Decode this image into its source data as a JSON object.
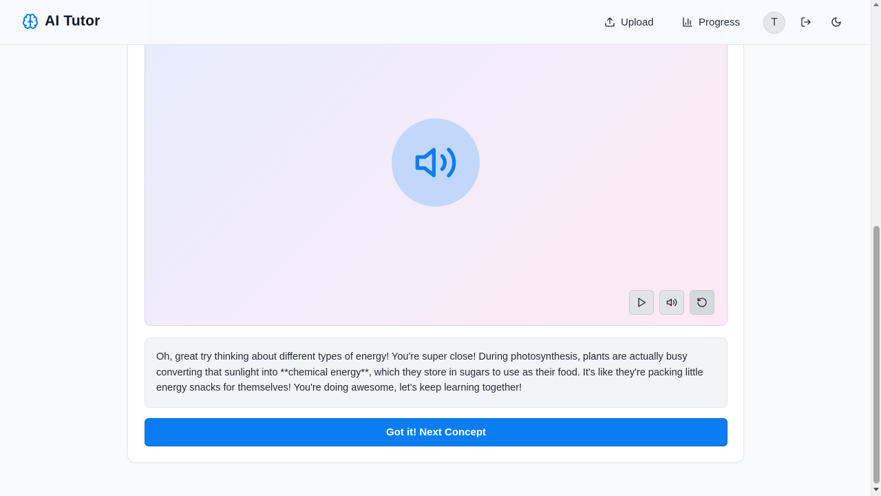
{
  "header": {
    "brand_title": "AI Tutor",
    "brand_icon": "brain-icon",
    "upload_label": "Upload",
    "progress_label": "Progress",
    "avatar_initial": "T",
    "logout_icon": "logout-icon",
    "theme_icon": "moon-icon"
  },
  "player": {
    "center_icon": "speaker-volume-icon",
    "controls": [
      {
        "name": "play-button",
        "icon": "play-icon"
      },
      {
        "name": "audio-button",
        "icon": "volume-icon"
      },
      {
        "name": "replay-button",
        "icon": "rotate-ccw-icon"
      }
    ]
  },
  "feedback": {
    "text": "Oh, great try thinking about different types of energy! You're super close! During photosynthesis, plants are actually busy converting that sunlight into **chemical energy**, which they store in sugars to use as their food. It's like they're packing little energy snacks for themselves! You're doing awesome, let's keep learning together!"
  },
  "actions": {
    "next_label": "Got it! Next Concept"
  },
  "colors": {
    "accent": "#0b7df2",
    "speaker_circle": "#c3d7fb",
    "speaker_icon": "#0b7df2"
  }
}
